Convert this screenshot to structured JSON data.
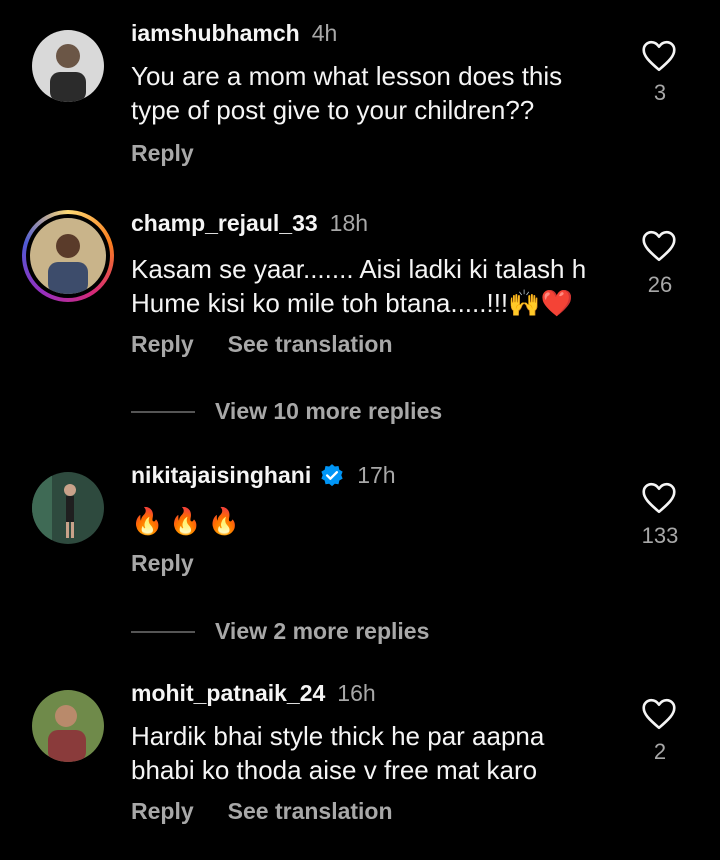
{
  "comments": [
    {
      "username": "iamshubhamch",
      "time": "4h",
      "text": "You are a mom what lesson does this type of post give to your children??",
      "likes": "3",
      "reply_label": "Reply"
    },
    {
      "username": "champ_rejaul_33",
      "time": "18h",
      "text_line1": "Kasam se yaar....... Aisi ladki ki talash h",
      "text_line2": "Hume kisi ko mile toh btana.....!!!",
      "emoji": "🙌❤️",
      "likes": "26",
      "reply_label": "Reply",
      "translate_label": "See translation",
      "more_replies": "View 10 more replies"
    },
    {
      "username": "nikitajaisinghani",
      "verified": true,
      "time": "17h",
      "emoji_text": "🔥🔥🔥",
      "likes": "133",
      "reply_label": "Reply",
      "more_replies": "View 2 more replies"
    },
    {
      "username": "mohit_patnaik_24",
      "time": "16h",
      "text": "Hardik bhai style thick he par aapna bhabi ko thoda aise v free mat karo",
      "likes": "2",
      "reply_label": "Reply",
      "translate_label": "See translation"
    }
  ],
  "colors": {
    "background": "#000000",
    "primary_text": "#f5f5f5",
    "secondary_text": "#a8a8a8",
    "verified_blue": "#0095f6"
  }
}
